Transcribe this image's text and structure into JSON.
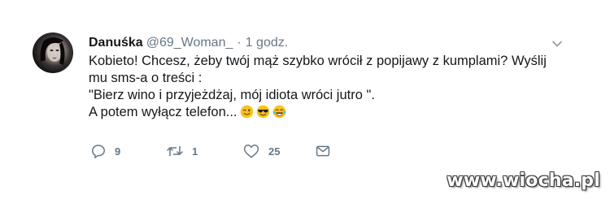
{
  "tweet": {
    "author_name": "Danuśka",
    "handle": "@69_Woman_",
    "separator": "·",
    "time": "1 godz.",
    "lines": [
      "Kobieto! Chcesz, żeby twój mąż szybko wrócił z popijawy z kumplami? Wyślij",
      "mu sms-a o treści :",
      "\"Bierz wino i przyjeżdżaj, mój idiota wróci jutro \".",
      "A potem wyłącz telefon..."
    ],
    "emojis": [
      "winking-face-emoji",
      "smiling-face-with-sunglasses-emoji",
      "face-with-tears-of-joy-emoji"
    ]
  },
  "actions": {
    "reply": {
      "icon": "reply-icon",
      "count": "9"
    },
    "retweet": {
      "icon": "retweet-icon",
      "count": "1"
    },
    "like": {
      "icon": "heart-icon",
      "count": "25"
    },
    "message": {
      "icon": "envelope-icon"
    }
  },
  "menu": {
    "icon": "chevron-down-icon"
  },
  "watermark": {
    "text": "www.wiocha.pl"
  },
  "colors": {
    "text": "#14171a",
    "secondary": "#657786",
    "background": "#ffffff"
  }
}
